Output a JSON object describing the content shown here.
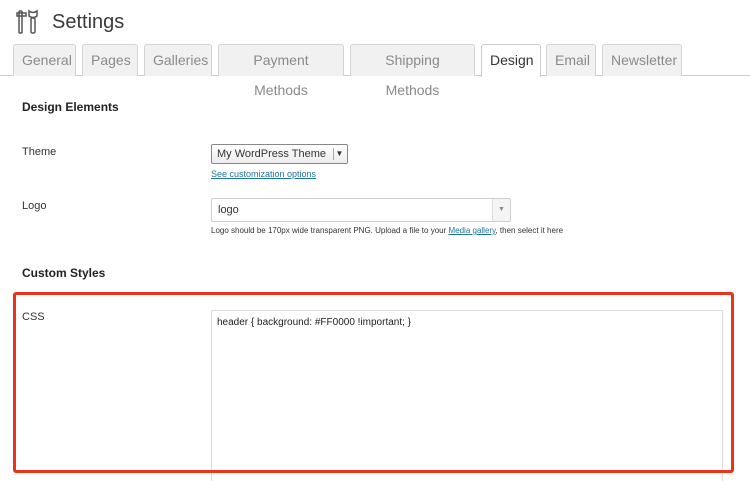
{
  "header": {
    "title": "Settings",
    "icon": "tools-icon"
  },
  "tabs": [
    {
      "label": "General",
      "active": false
    },
    {
      "label": "Pages",
      "active": false
    },
    {
      "label": "Galleries",
      "active": false
    },
    {
      "label": "Payment Methods",
      "active": false
    },
    {
      "label": "Shipping Methods",
      "active": false
    },
    {
      "label": "Design",
      "active": true
    },
    {
      "label": "Email",
      "active": false
    },
    {
      "label": "Newsletter",
      "active": false
    }
  ],
  "design_elements": {
    "heading": "Design Elements",
    "theme": {
      "label": "Theme",
      "selected": "My WordPress Theme",
      "link": "See customization options"
    },
    "logo": {
      "label": "Logo",
      "selected": "logo",
      "help_prefix": "Logo should be 170px wide transparent PNG. Upload a file to your ",
      "help_link": "Media gallery",
      "help_suffix": ", then select it here"
    }
  },
  "custom_styles": {
    "heading": "Custom Styles",
    "css": {
      "label": "CSS",
      "value": "header { background: #FF0000 !important; }"
    }
  },
  "colors": {
    "highlight": "#e8341c",
    "link": "#21759b"
  }
}
